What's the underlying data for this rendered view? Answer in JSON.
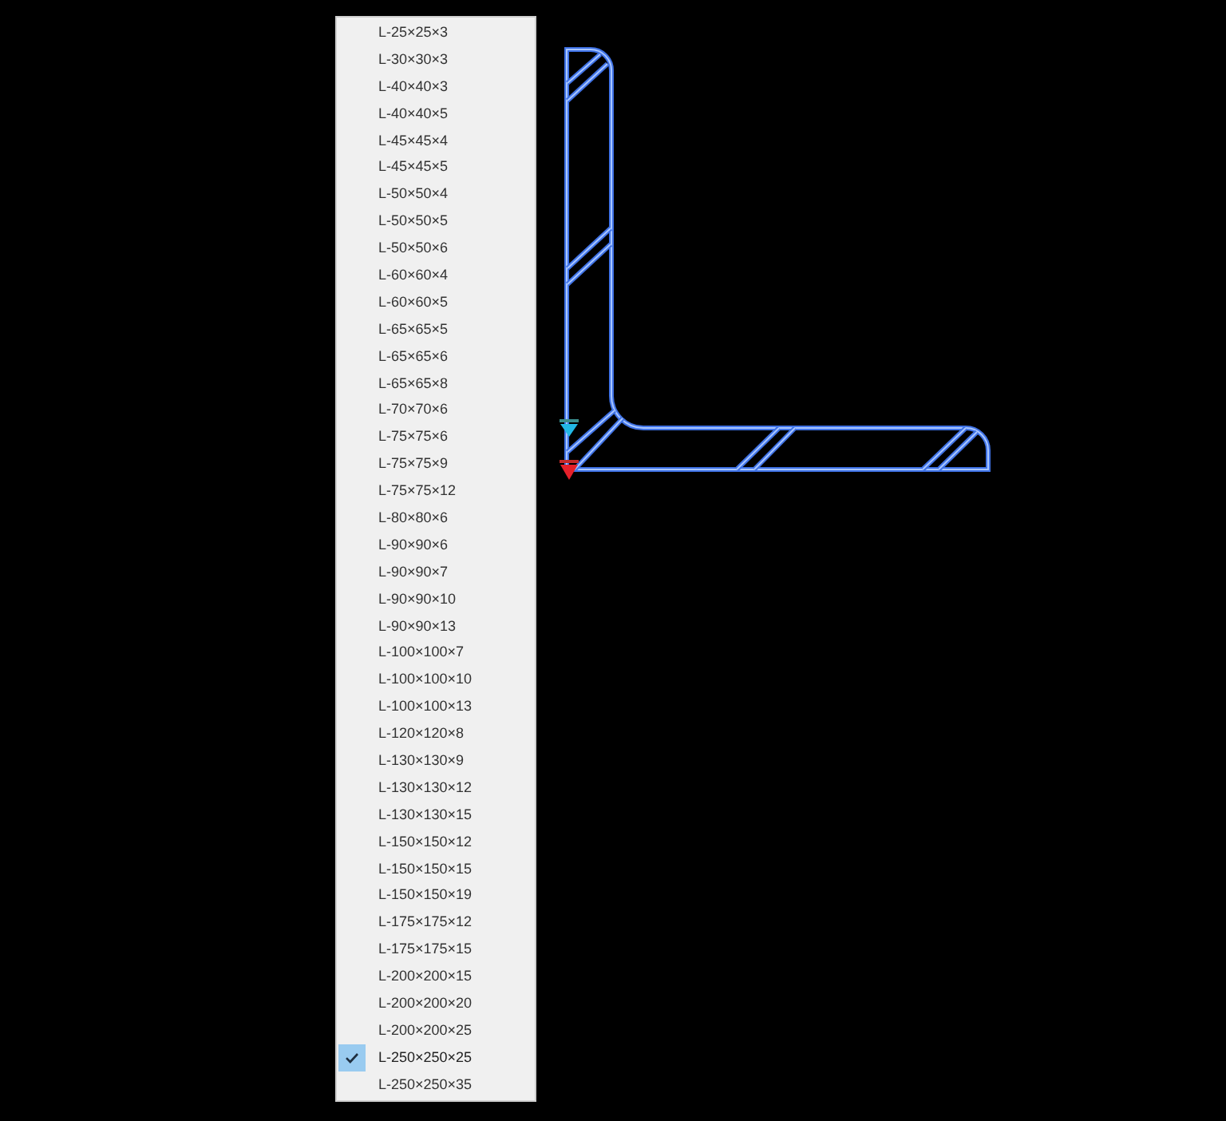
{
  "menu": {
    "items": [
      {
        "label": "L-25×25×3",
        "selected": false
      },
      {
        "label": "L-30×30×3",
        "selected": false
      },
      {
        "label": "L-40×40×3",
        "selected": false
      },
      {
        "label": "L-40×40×5",
        "selected": false
      },
      {
        "label": "L-45×45×4",
        "selected": false
      },
      {
        "label": "L-45×45×5",
        "selected": false
      },
      {
        "label": "L-50×50×4",
        "selected": false
      },
      {
        "label": "L-50×50×5",
        "selected": false
      },
      {
        "label": "L-50×50×6",
        "selected": false
      },
      {
        "label": "L-60×60×4",
        "selected": false
      },
      {
        "label": "L-60×60×5",
        "selected": false
      },
      {
        "label": "L-65×65×5",
        "selected": false
      },
      {
        "label": "L-65×65×6",
        "selected": false
      },
      {
        "label": "L-65×65×8",
        "selected": false
      },
      {
        "label": "L-70×70×6",
        "selected": false
      },
      {
        "label": "L-75×75×6",
        "selected": false
      },
      {
        "label": "L-75×75×9",
        "selected": false
      },
      {
        "label": "L-75×75×12",
        "selected": false
      },
      {
        "label": "L-80×80×6",
        "selected": false
      },
      {
        "label": "L-90×90×6",
        "selected": false
      },
      {
        "label": "L-90×90×7",
        "selected": false
      },
      {
        "label": "L-90×90×10",
        "selected": false
      },
      {
        "label": "L-90×90×13",
        "selected": false
      },
      {
        "label": "L-100×100×7",
        "selected": false
      },
      {
        "label": "L-100×100×10",
        "selected": false
      },
      {
        "label": "L-100×100×13",
        "selected": false
      },
      {
        "label": "L-120×120×8",
        "selected": false
      },
      {
        "label": "L-130×130×9",
        "selected": false
      },
      {
        "label": "L-130×130×12",
        "selected": false
      },
      {
        "label": "L-130×130×15",
        "selected": false
      },
      {
        "label": "L-150×150×12",
        "selected": false
      },
      {
        "label": "L-150×150×15",
        "selected": false
      },
      {
        "label": "L-150×150×19",
        "selected": false
      },
      {
        "label": "L-175×175×12",
        "selected": false
      },
      {
        "label": "L-175×175×15",
        "selected": false
      },
      {
        "label": "L-200×200×15",
        "selected": false
      },
      {
        "label": "L-200×200×20",
        "selected": false
      },
      {
        "label": "L-200×200×25",
        "selected": false
      },
      {
        "label": "L-250×250×25",
        "selected": true
      },
      {
        "label": "L-250×250×35",
        "selected": false
      }
    ]
  }
}
